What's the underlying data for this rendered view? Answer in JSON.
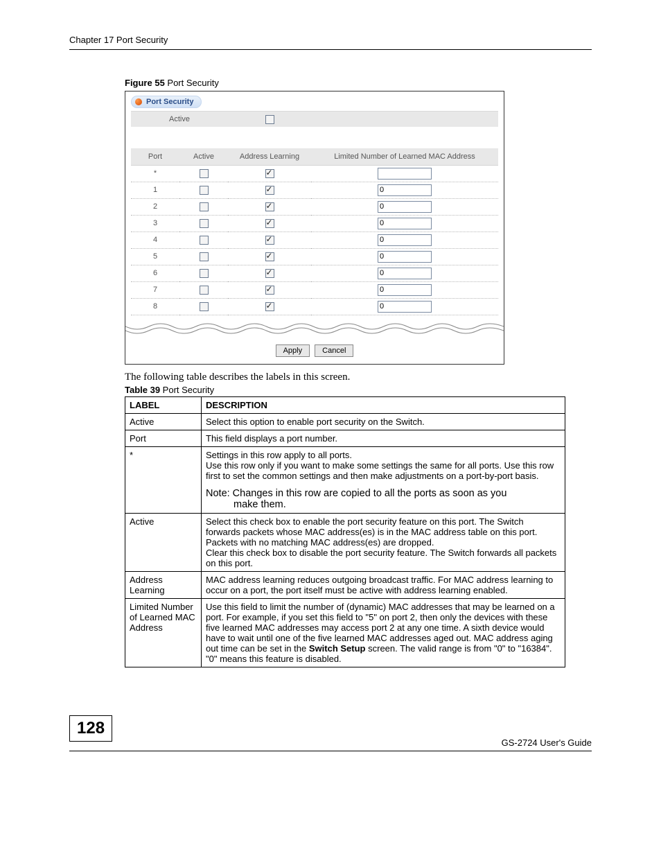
{
  "chapter_header": "Chapter 17 Port Security",
  "figure_caption_bold": "Figure 55",
  "figure_caption_rest": "   Port Security",
  "screenshot": {
    "title": "Port Security",
    "active_label": "Active",
    "headers": {
      "port": "Port",
      "active": "Active",
      "addr_learn": "Address Learning",
      "limited": "Limited Number of Learned MAC Address"
    },
    "rows": [
      {
        "port": "*",
        "active": false,
        "learn": true,
        "limit": ""
      },
      {
        "port": "1",
        "active": false,
        "learn": true,
        "limit": "0"
      },
      {
        "port": "2",
        "active": false,
        "learn": true,
        "limit": "0"
      },
      {
        "port": "3",
        "active": false,
        "learn": true,
        "limit": "0"
      },
      {
        "port": "4",
        "active": false,
        "learn": true,
        "limit": "0"
      },
      {
        "port": "5",
        "active": false,
        "learn": true,
        "limit": "0"
      },
      {
        "port": "6",
        "active": false,
        "learn": true,
        "limit": "0"
      },
      {
        "port": "7",
        "active": false,
        "learn": true,
        "limit": "0"
      },
      {
        "port": "8",
        "active": false,
        "learn": true,
        "limit": "0"
      }
    ],
    "apply_btn": "Apply",
    "cancel_btn": "Cancel"
  },
  "intro_line": "The following table describes the labels in this screen.",
  "table_caption_bold": "Table 39",
  "table_caption_rest": "   Port Security",
  "desc_headers": {
    "label": "LABEL",
    "description": "DESCRIPTION"
  },
  "desc_rows": [
    {
      "label": "Active",
      "desc": "Select this option to enable port security on the Switch."
    },
    {
      "label": "Port",
      "desc": "This field displays a port number."
    },
    {
      "label": "*",
      "desc_a": "Settings in this row apply to all ports.",
      "desc_b": "Use this row only if you want to make some settings the same for all ports. Use this row first to set the common settings and then make adjustments on a port-by-port basis.",
      "note1": "Note: Changes in this row are copied to all the ports as soon as you",
      "note2": "make them."
    },
    {
      "label": "Active",
      "desc_a": "Select this check box to enable the port security feature on this port. The Switch forwards packets whose MAC address(es) is in the MAC address table on this port. Packets with no matching MAC address(es) are dropped.",
      "desc_b": "Clear this check box to disable the port security feature. The Switch forwards all packets on this port."
    },
    {
      "label": "Address Learning",
      "desc": "MAC address learning reduces outgoing broadcast traffic. For MAC address learning to occur on a port, the port itself must be active with address learning enabled."
    },
    {
      "label": "Limited Number of Learned MAC Address",
      "desc_a": "Use this field to limit the number of (dynamic) MAC addresses that may be learned on a port. For example, if you set this field to \"5\" on port 2, then only the devices with these five learned MAC addresses may access port 2 at any one time. A sixth device would have to wait until one of the five learned MAC addresses aged out. MAC address aging out time can be set in the ",
      "desc_bold": "Switch Setup",
      "desc_b": " screen. The valid range is from \"0\" to \"16384\". \"0\" means this feature is disabled."
    }
  ],
  "page_number": "128",
  "guide": "GS-2724 User's Guide"
}
